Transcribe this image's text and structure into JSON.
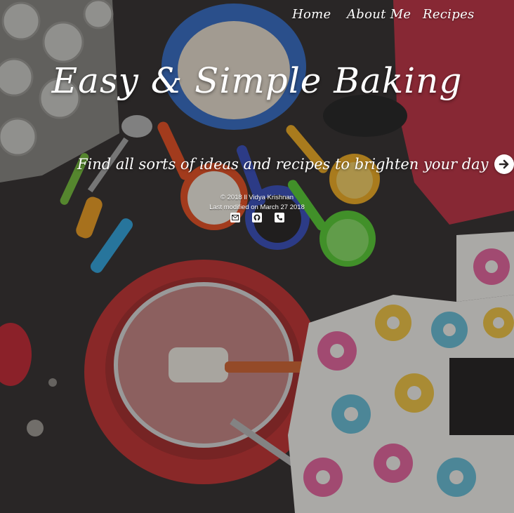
{
  "nav": {
    "items": [
      {
        "label": "Home"
      },
      {
        "label": "About Me"
      },
      {
        "label": "Recipes"
      }
    ]
  },
  "hero": {
    "title": "Easy & Simple Baking",
    "tagline": "Find all sorts of ideas and recipes to brighten your day",
    "arrow_icon": "arrow-right-circle-icon"
  },
  "footer": {
    "copyright": "© 2018 ll Vidya Krishnan",
    "last_modified": "Last modified on March 27 2018",
    "icons": [
      "email-icon",
      "github-icon",
      "phone-icon"
    ]
  },
  "colors": {
    "text": "#ffffff",
    "overlay": "#000000"
  }
}
